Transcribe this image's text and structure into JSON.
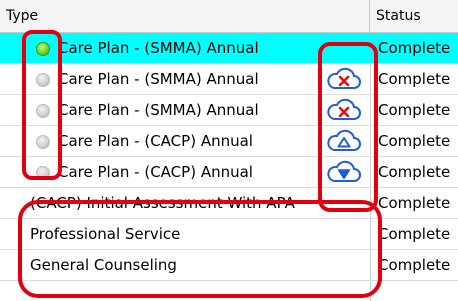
{
  "header": {
    "type_label": "Type",
    "status_label": "Status"
  },
  "rows": [
    {
      "type": "Care Plan - (SMMA) Annual",
      "status": "Complete",
      "indicator": "active",
      "cloud": "none"
    },
    {
      "type": "Care Plan - (SMMA) Annual",
      "status": "Complete",
      "indicator": "idle",
      "cloud": "cloud-error-icon"
    },
    {
      "type": "Care Plan - (SMMA) Annual",
      "status": "Complete",
      "indicator": "idle",
      "cloud": "cloud-error-icon"
    },
    {
      "type": "Care Plan - (CACP) Annual",
      "status": "Complete",
      "indicator": "idle",
      "cloud": "cloud-upload-icon"
    },
    {
      "type": "Care Plan - (CACP) Annual",
      "status": "Complete",
      "indicator": "idle",
      "cloud": "cloud-download-icon"
    },
    {
      "type": "(CACP) Initial Assessment With APA",
      "status": "Complete",
      "indicator": "none",
      "cloud": "none"
    },
    {
      "type": "Professional Service",
      "status": "Complete",
      "indicator": "none",
      "cloud": "none"
    },
    {
      "type": "General Counseling",
      "status": "Complete",
      "indicator": "none",
      "cloud": "none"
    }
  ],
  "colors": {
    "selected_row": "#00ffff",
    "annotation": "#e00010",
    "cloud_outline": "#1e5fd6",
    "cloud_error": "#e01010"
  }
}
